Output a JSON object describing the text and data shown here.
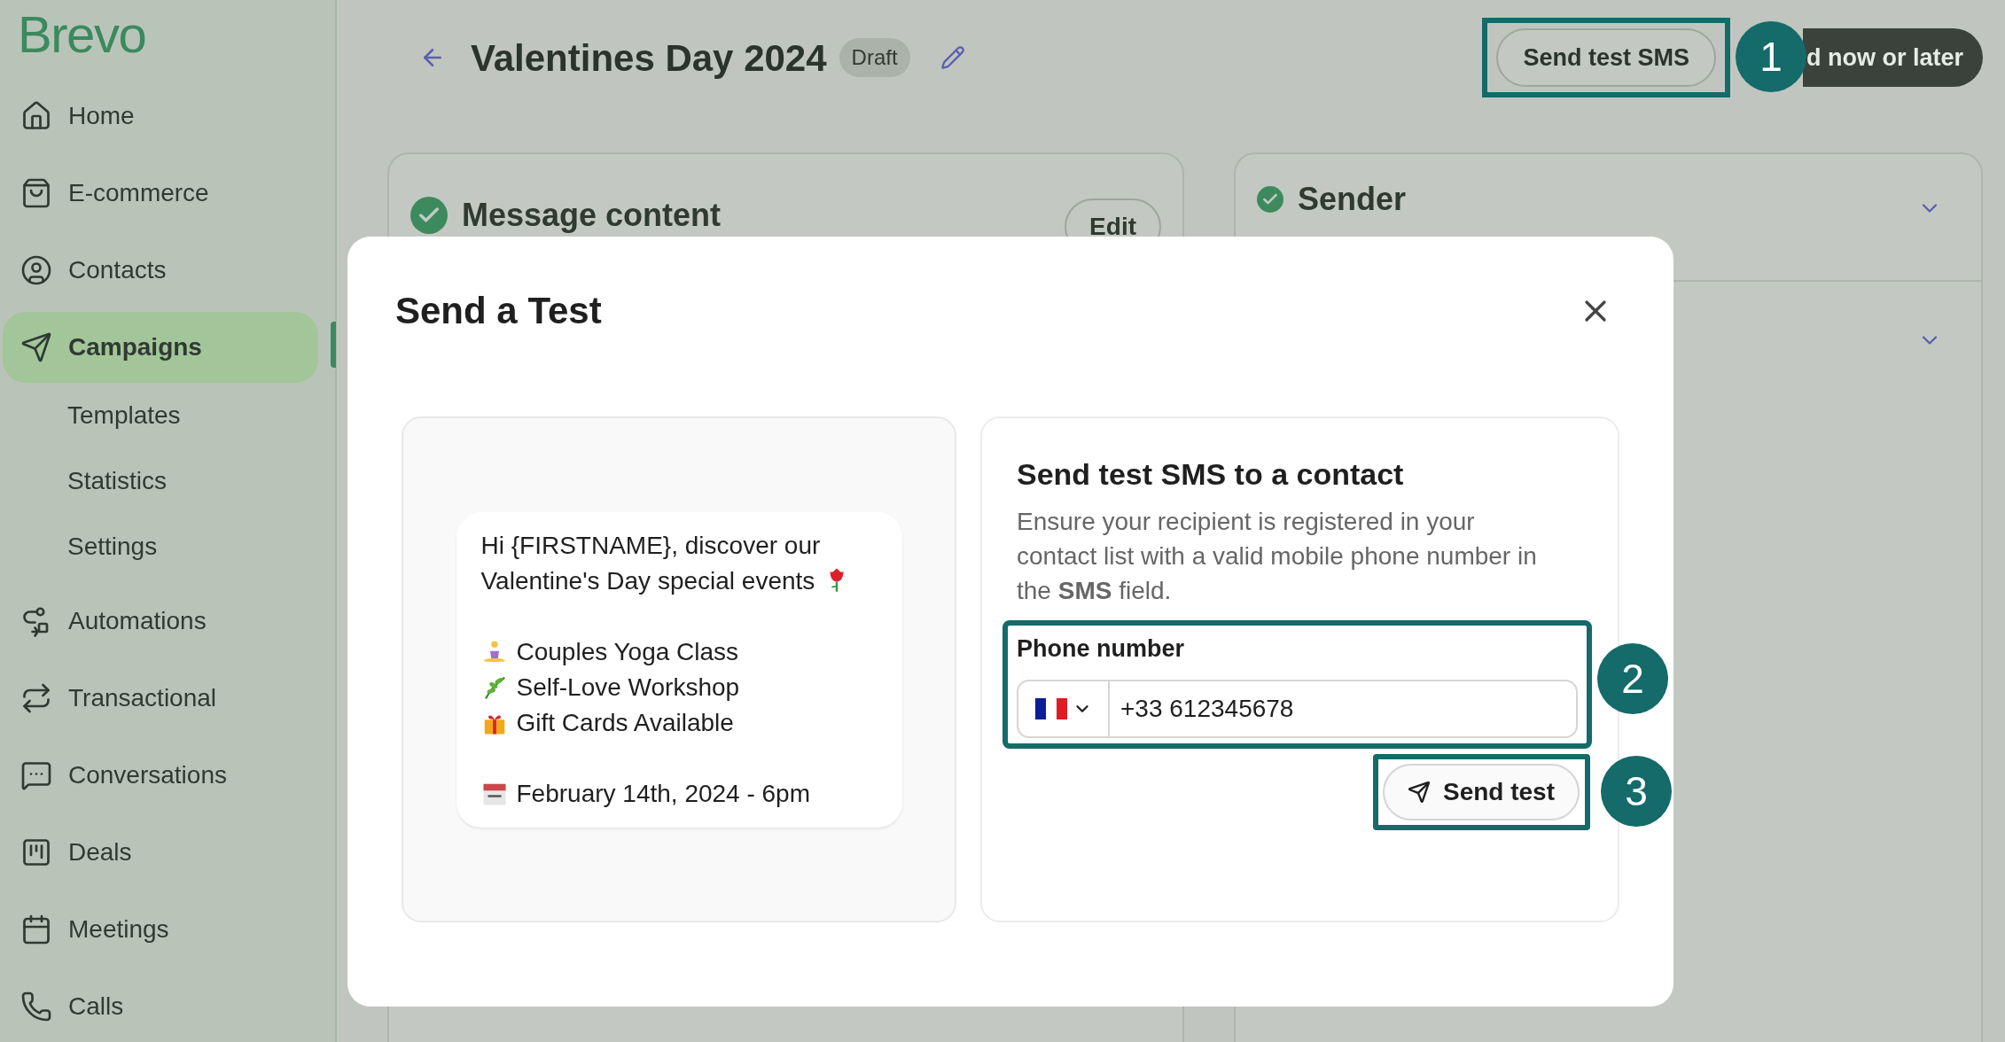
{
  "logo": "Brevo",
  "sidebar": {
    "items": [
      {
        "label": "Home",
        "selected": false
      },
      {
        "label": "E-commerce",
        "selected": false
      },
      {
        "label": "Contacts",
        "selected": false
      },
      {
        "label": "Campaigns",
        "selected": true,
        "children": [
          {
            "label": "Templates"
          },
          {
            "label": "Statistics"
          },
          {
            "label": "Settings"
          }
        ]
      },
      {
        "label": "Automations",
        "selected": false
      },
      {
        "label": "Transactional",
        "selected": false
      },
      {
        "label": "Conversations",
        "selected": false
      },
      {
        "label": "Deals",
        "selected": false
      },
      {
        "label": "Meetings",
        "selected": false
      },
      {
        "label": "Calls",
        "selected": false
      }
    ]
  },
  "header": {
    "title": "Valentines Day 2024",
    "status": "Draft",
    "buttons": [
      {
        "label": "Send test SMS",
        "kind": "outline",
        "annotation": "1"
      },
      {
        "label": "d now or later",
        "kind": "dark"
      }
    ]
  },
  "cards": [
    {
      "title": "Message content",
      "done": true,
      "button": "Edit"
    },
    {
      "title": "Sender",
      "done": true
    }
  ],
  "modal": {
    "title": "Send a Test",
    "sms_preview": {
      "intro": "Hi {FIRSTNAME}, discover our Valentine's Day special events",
      "lines": [
        {
          "kind": "yoga",
          "text": "Couples Yoga Class"
        },
        {
          "kind": "leaf",
          "text": "Self-Love Workshop"
        },
        {
          "kind": "gift",
          "text": "Gift Cards Available"
        }
      ],
      "date": "February 14th, 2024 - 6pm"
    },
    "form": {
      "heading": "Send test SMS to a contact",
      "description": "Ensure your recipient is registered in your contact list with a valid mobile phone number in the **SMS** field.",
      "phone_label": "Phone number",
      "phone_value": "+33 612345678",
      "phone_annotation": "2",
      "send_button": "Send test",
      "send_annotation": "3"
    }
  }
}
